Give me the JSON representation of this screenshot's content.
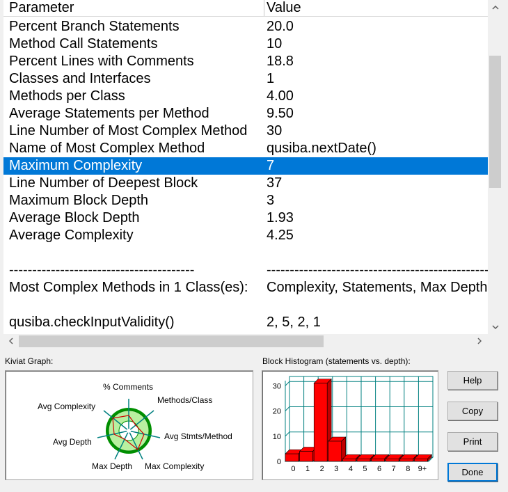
{
  "table": {
    "headers": [
      "Parameter",
      "Value"
    ],
    "rows": [
      {
        "param": "Percent Branch Statements",
        "value": "20.0"
      },
      {
        "param": "Method Call Statements",
        "value": "10"
      },
      {
        "param": "Percent Lines with Comments",
        "value": "18.8"
      },
      {
        "param": "Classes and Interfaces",
        "value": "1"
      },
      {
        "param": "Methods per Class",
        "value": "4.00"
      },
      {
        "param": "Average Statements per Method",
        "value": "9.50"
      },
      {
        "param": "Line Number of Most Complex Method",
        "value": "30"
      },
      {
        "param": "Name of Most Complex Method",
        "value": "qusiba.nextDate()"
      },
      {
        "param": "Maximum Complexity",
        "value": "7",
        "selected": true
      },
      {
        "param": "Line Number of Deepest Block",
        "value": "37"
      },
      {
        "param": "Maximum Block Depth",
        "value": "3"
      },
      {
        "param": "Average Block Depth",
        "value": "1.93"
      },
      {
        "param": "Average Complexity",
        "value": "4.25"
      },
      {
        "param": "",
        "value": ""
      },
      {
        "param": "----------------------------------------",
        "value": "--------------------------------------------------"
      },
      {
        "param": "Most Complex Methods in 1 Class(es):",
        "value": "Complexity, Statements, Max Depth"
      },
      {
        "param": "",
        "value": ""
      },
      {
        "param": "qusiba.checkInputValidity()",
        "value": "2, 5, 2, 1"
      }
    ]
  },
  "kiviat": {
    "title": "Kiviat Graph:",
    "axes": [
      "% Comments",
      "Methods/Class",
      "Avg Stmts/Method",
      "Max Complexity",
      "Max Depth",
      "Avg Depth",
      "Avg Complexity"
    ]
  },
  "histogram": {
    "title": "Block Histogram (statements vs. depth):",
    "categories": [
      "0",
      "1",
      "2",
      "3",
      "4",
      "5",
      "6",
      "7",
      "8",
      "9+"
    ],
    "values": [
      3,
      4,
      31,
      8,
      1,
      1,
      1,
      1,
      1,
      1
    ],
    "yticks": [
      "0",
      "10",
      "20",
      "30"
    ],
    "ylim": [
      0,
      32
    ],
    "bar_color": "#ff0000"
  },
  "buttons": {
    "help": "Help",
    "copy": "Copy",
    "print": "Print",
    "done": "Done"
  },
  "icons": {
    "scroll_up": "chevron-up-icon",
    "scroll_down": "chevron-down-icon",
    "scroll_left": "chevron-left-icon",
    "scroll_right": "chevron-right-icon"
  }
}
